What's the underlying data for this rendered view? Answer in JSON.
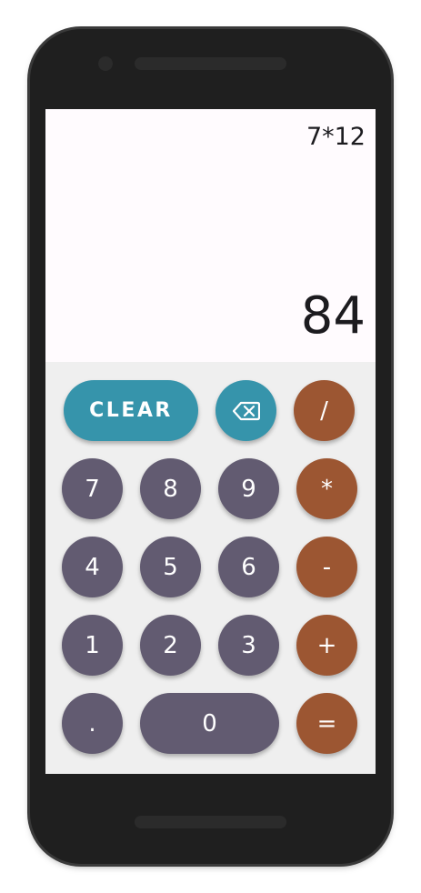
{
  "display": {
    "expression": "7*12",
    "result": "84"
  },
  "keys": {
    "clear": "CLEAR",
    "backspace_icon": "backspace-icon",
    "divide": "/",
    "multiply": "*",
    "subtract": "-",
    "add": "+",
    "equals": "=",
    "seven": "7",
    "eight": "8",
    "nine": "9",
    "four": "4",
    "five": "5",
    "six": "6",
    "one": "1",
    "two": "2",
    "three": "3",
    "decimal": ".",
    "zero": "0"
  },
  "colors": {
    "number_key": "#625b71",
    "operator_key": "#9c5632",
    "function_key": "#3694ab",
    "display_background": "#fffbfe",
    "keypad_background": "#efefef"
  }
}
